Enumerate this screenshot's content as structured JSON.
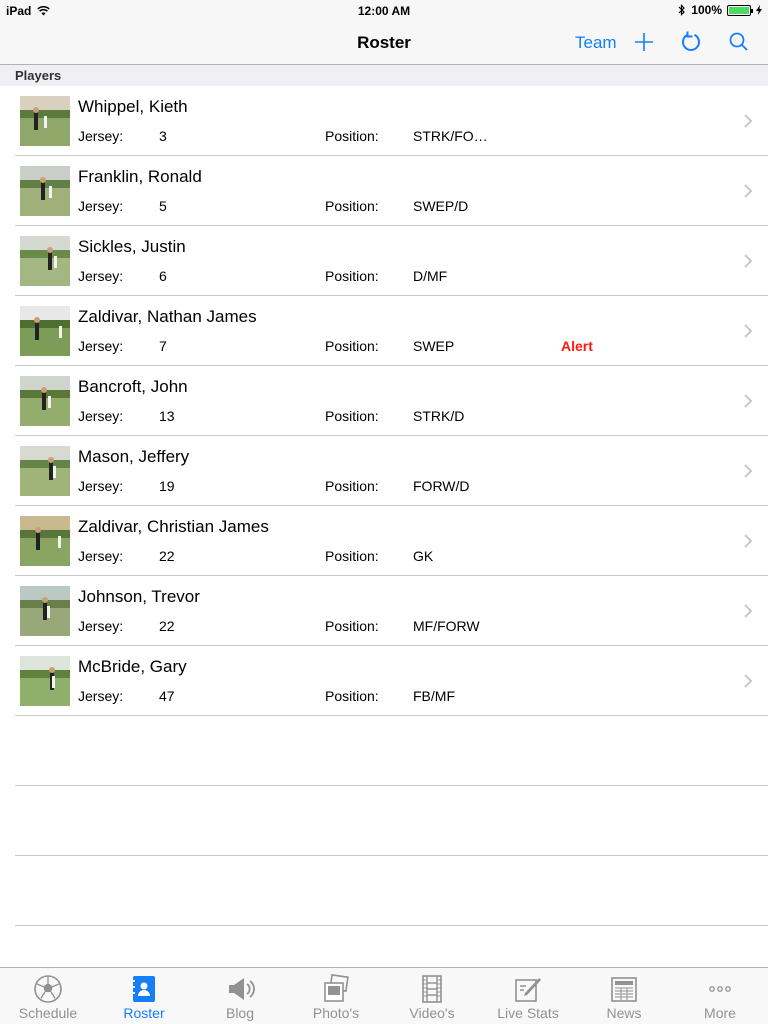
{
  "status": {
    "device": "iPad",
    "time": "12:00 AM",
    "battery": "100%",
    "battery_level": 1.0
  },
  "nav": {
    "title": "Roster",
    "team_label": "Team",
    "accent": "#157efb"
  },
  "section": {
    "header": "Players"
  },
  "labels": {
    "jersey": "Jersey:",
    "position": "Position:"
  },
  "players": [
    {
      "name": "Whippel, Kieth",
      "jersey": "3",
      "position": "STRK/FO…",
      "alert": ""
    },
    {
      "name": "Franklin, Ronald",
      "jersey": "5",
      "position": "SWEP/D",
      "alert": ""
    },
    {
      "name": "Sickles, Justin",
      "jersey": "6",
      "position": "D/MF",
      "alert": ""
    },
    {
      "name": "Zaldivar, Nathan James",
      "jersey": "7",
      "position": "SWEP",
      "alert": "Alert"
    },
    {
      "name": "Bancroft, John",
      "jersey": "13",
      "position": "STRK/D",
      "alert": ""
    },
    {
      "name": "Mason, Jeffery",
      "jersey": "19",
      "position": "FORW/D",
      "alert": ""
    },
    {
      "name": "Zaldivar, Christian James",
      "jersey": "22",
      "position": "GK",
      "alert": ""
    },
    {
      "name": "Johnson, Trevor",
      "jersey": "22",
      "position": "MF/FORW",
      "alert": ""
    },
    {
      "name": "McBride, Gary",
      "jersey": "47",
      "position": "FB/MF",
      "alert": ""
    }
  ],
  "tabs": [
    {
      "label": "Schedule",
      "icon": "soccer-ball-icon",
      "active": false
    },
    {
      "label": "Roster",
      "icon": "roster-book-icon",
      "active": true
    },
    {
      "label": "Blog",
      "icon": "megaphone-icon",
      "active": false
    },
    {
      "label": "Photo's",
      "icon": "photos-icon",
      "active": false
    },
    {
      "label": "Video's",
      "icon": "film-strip-icon",
      "active": false
    },
    {
      "label": "Live Stats",
      "icon": "edit-notepad-icon",
      "active": false
    },
    {
      "label": "News",
      "icon": "newspaper-icon",
      "active": false
    },
    {
      "label": "More",
      "icon": "more-dots-icon",
      "active": false
    }
  ]
}
